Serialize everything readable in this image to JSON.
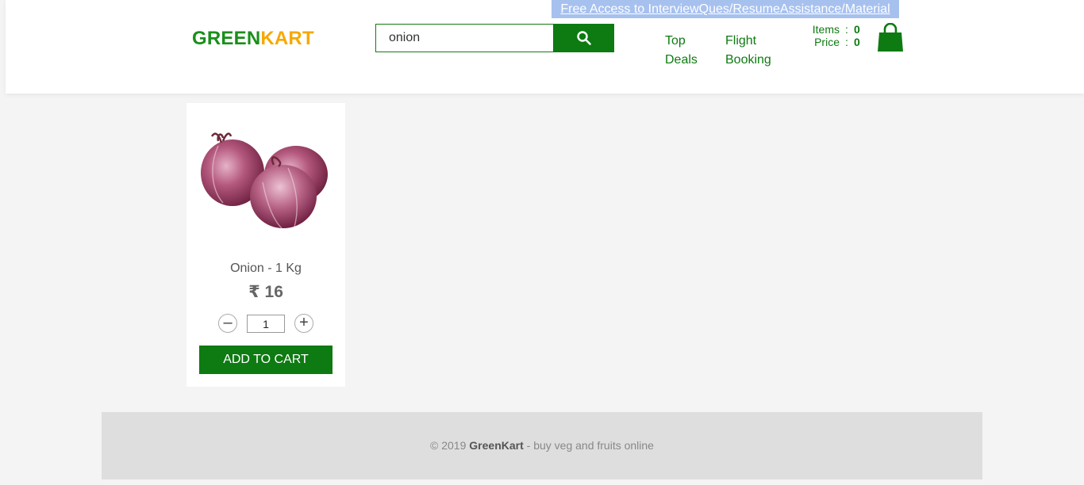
{
  "promo": {
    "text": "Free Access to InterviewQues/ResumeAssistance/Material"
  },
  "brand": {
    "part1": "GREEN",
    "part2": "KART",
    "color1": "#1a8f1a",
    "color2": "#f7a800"
  },
  "search": {
    "value": "onion",
    "button_icon": "search-icon"
  },
  "nav": [
    {
      "label": "Top Deals"
    },
    {
      "label": "Flight Booking"
    }
  ],
  "cart": {
    "items_label": "Items",
    "items_value": "0",
    "price_label": "Price",
    "price_value": "0",
    "separator": ":",
    "icon": "shopping-bag-icon"
  },
  "products": [
    {
      "name": "Onion - 1 Kg",
      "price": "₹ 16",
      "quantity": "1",
      "add_label": "ADD TO CART",
      "image_icon": "onion-image"
    }
  ],
  "footer": {
    "prefix": "© 2019",
    "brand": "GreenKart",
    "suffix": "- buy veg and fruits online"
  },
  "colors": {
    "primary_green": "#0e7a12",
    "banner": "#a7c1ef",
    "background": "#f4f4f4",
    "footer_bg": "#dedede"
  }
}
